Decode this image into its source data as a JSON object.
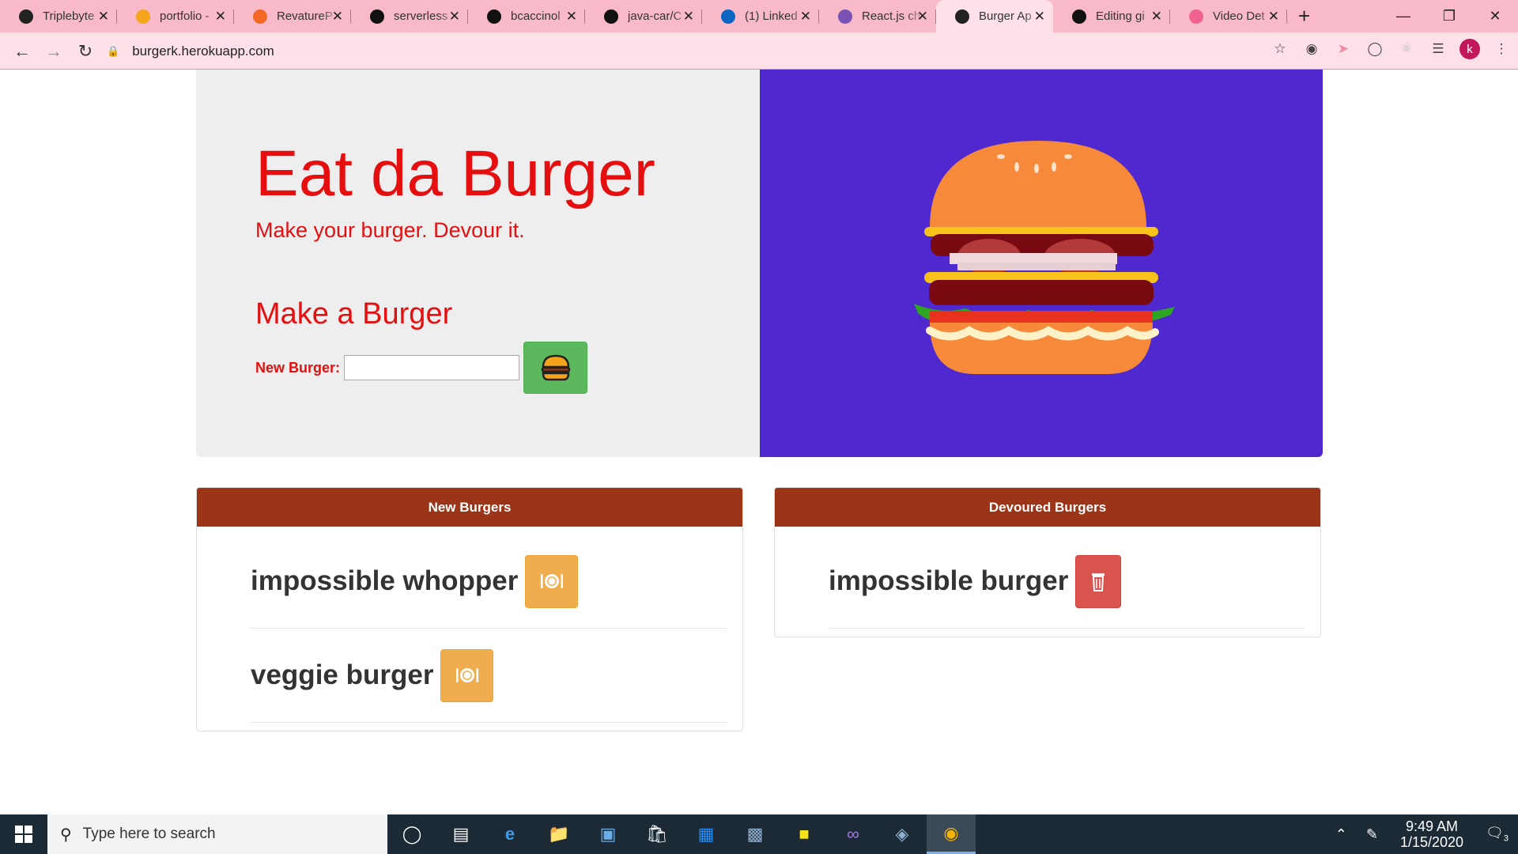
{
  "browser": {
    "tabs": [
      {
        "title": "Triplebyte",
        "icon": "triplebyte-icon",
        "color": "#222222"
      },
      {
        "title": "portfolio -",
        "icon": "firebase-icon",
        "color": "#f6a31d"
      },
      {
        "title": "RevatureP",
        "icon": "revature-icon",
        "color": "#f26925"
      },
      {
        "title": "serverless",
        "icon": "github-icon",
        "color": "#111111"
      },
      {
        "title": "bcaccinol",
        "icon": "github-icon",
        "color": "#111111"
      },
      {
        "title": "java-car/C",
        "icon": "github-icon",
        "color": "#111111"
      },
      {
        "title": "(1) Linked",
        "icon": "linkedin-icon",
        "color": "#0a66c2"
      },
      {
        "title": "React.js ch",
        "icon": "bootstrap-icon",
        "color": "#7952b3"
      },
      {
        "title": "Burger Ap",
        "icon": "globe-icon",
        "color": "#222222",
        "active": true
      },
      {
        "title": "Editing gi",
        "icon": "github-icon",
        "color": "#111111"
      },
      {
        "title": "Video Det",
        "icon": "video-icon",
        "color": "#f06292"
      }
    ],
    "url": "burgerk.herokuapp.com",
    "profile_initial": "k"
  },
  "hero": {
    "title": "Eat da Burger",
    "subtitle": "Make your burger. Devour it.",
    "form_title": "Make a Burger",
    "input_label": "New Burger:",
    "input_value": ""
  },
  "new_panel": {
    "heading": "New Burgers",
    "items": [
      {
        "name": "impossible whopper"
      },
      {
        "name": "veggie burger"
      }
    ]
  },
  "devoured_panel": {
    "heading": "Devoured Burgers",
    "items": [
      {
        "name": "impossible burger"
      }
    ]
  },
  "taskbar": {
    "search_placeholder": "Type here to search",
    "time": "9:49 AM",
    "date": "1/15/2020",
    "notifications": "3"
  },
  "colors": {
    "accent_red": "#e50f0f",
    "hero_purple": "#4f28d0",
    "panel_header": "#9c3418",
    "btn_green": "#5cb85c",
    "btn_orange": "#f0ad4e",
    "btn_red": "#d9534f"
  }
}
